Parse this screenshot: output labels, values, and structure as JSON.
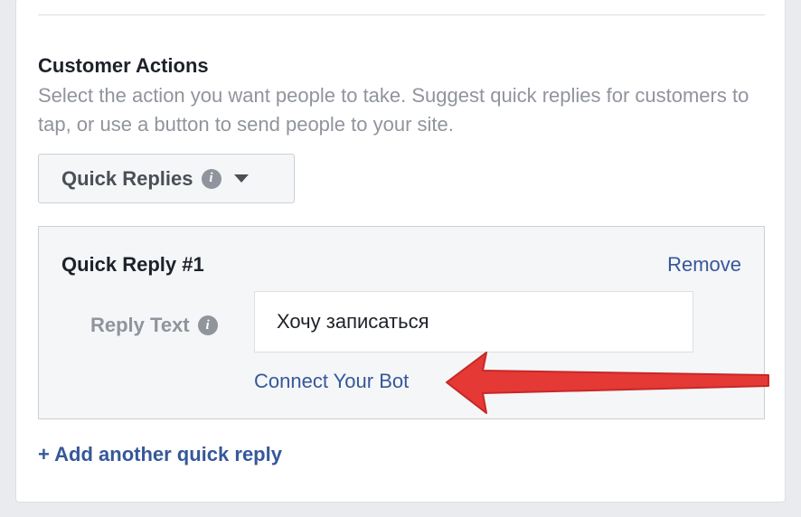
{
  "section": {
    "title": "Customer Actions",
    "description": "Select the action you want people to take. Suggest quick replies for customers to tap, or use a button to send people to your site."
  },
  "dropdown": {
    "selected": "Quick Replies",
    "info_icon": "info-icon",
    "caret_icon": "caret-down-icon"
  },
  "quick_reply": {
    "title": "Quick Reply #1",
    "remove_label": "Remove",
    "field_label": "Reply Text",
    "field_value": "Хочу записаться",
    "connect_label": "Connect Your Bot"
  },
  "add_reply_label": "+ Add another quick reply",
  "annotation": {
    "icon": "red-arrow-icon",
    "color": "#e53935"
  },
  "colors": {
    "link": "#365899",
    "muted": "#90949c",
    "text": "#1d2129"
  }
}
